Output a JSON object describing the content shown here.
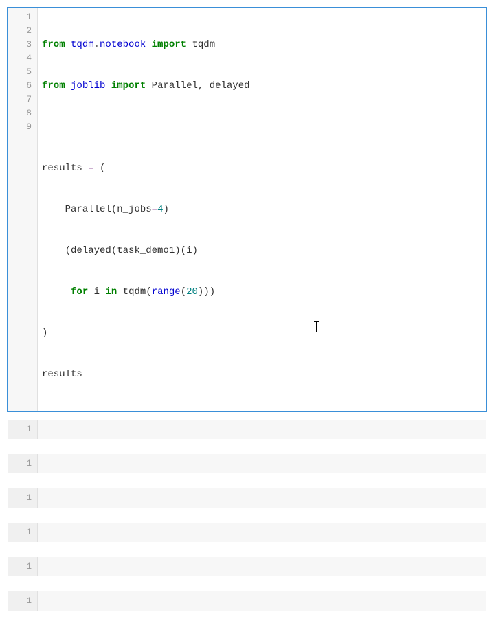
{
  "main_cell": {
    "line_numbers": [
      "1",
      "2",
      "3",
      "4",
      "5",
      "6",
      "7",
      "8",
      "9"
    ],
    "tokens": {
      "from": "from",
      "import": "import",
      "for": "for",
      "in": "in",
      "tqdm_mod": "tqdm",
      "notebook": "notebook",
      "tqdm": "tqdm",
      "joblib": "joblib",
      "Parallel": "Parallel",
      "delayed": "delayed",
      "results": "results",
      "n_jobs": "n_jobs",
      "task_demo1": "task_demo1",
      "i": "i",
      "range": "range",
      "eq": "=",
      "four": "4",
      "twenty": "20",
      "comma": ", ",
      "dot": ".",
      "lp": "(",
      "rp": ")",
      "sp4": "    ",
      "sp5": "     ",
      "space": " "
    }
  },
  "output_cells": [
    {
      "ln": "1"
    },
    {
      "ln": "1"
    },
    {
      "ln": "1"
    },
    {
      "ln": "1"
    },
    {
      "ln": "1"
    },
    {
      "ln": "1"
    }
  ]
}
